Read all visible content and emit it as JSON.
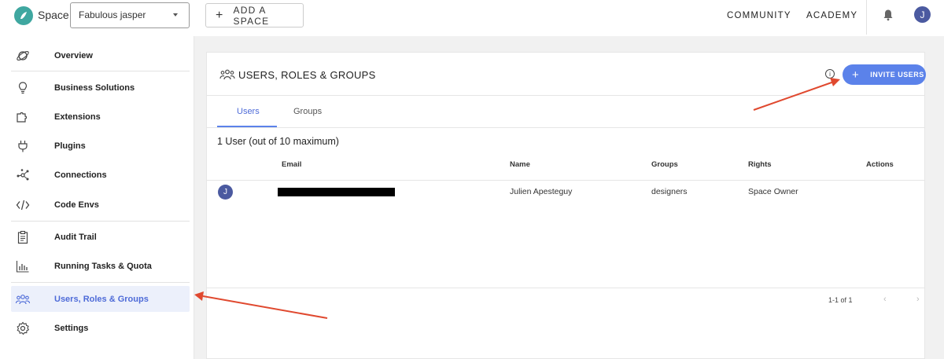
{
  "header": {
    "app_name": "Space",
    "space_selector": "Fabulous jasper",
    "add_space": "ADD A SPACE",
    "links": [
      "COMMUNITY",
      "ACADEMY"
    ],
    "user_initial": "J"
  },
  "sidebar": {
    "items": [
      {
        "label": "Overview",
        "icon": "planet-icon"
      },
      {
        "label": "Business Solutions",
        "icon": "lightbulb-icon"
      },
      {
        "label": "Extensions",
        "icon": "puzzle-icon"
      },
      {
        "label": "Plugins",
        "icon": "plug-icon"
      },
      {
        "label": "Connections",
        "icon": "connections-icon"
      },
      {
        "label": "Code Envs",
        "icon": "code-icon"
      },
      {
        "label": "Audit Trail",
        "icon": "clipboard-icon"
      },
      {
        "label": "Running Tasks & Quota",
        "icon": "bar-chart-icon"
      },
      {
        "label": "Users, Roles & Groups",
        "icon": "users-icon",
        "active": true
      },
      {
        "label": "Settings",
        "icon": "gear-icon"
      }
    ]
  },
  "main": {
    "title": "USERS, ROLES & GROUPS",
    "invite_button": "INVITE USERS",
    "tabs": [
      {
        "label": "Users",
        "active": true
      },
      {
        "label": "Groups"
      }
    ],
    "user_count": "1 User (out of 10 maximum)",
    "table": {
      "columns": [
        "Email",
        "Name",
        "Groups",
        "Rights",
        "Actions"
      ],
      "rows": [
        {
          "avatar": "J",
          "email": "",
          "name": "Julien Apesteguy",
          "groups": "designers",
          "rights": "Space Owner"
        }
      ]
    },
    "pagination": "1-1 of 1"
  },
  "colors": {
    "accent": "#5b82ea",
    "logo": "#3fa7a0",
    "avatar": "#4b5aa0",
    "annotation_arrow": "#e0492f"
  }
}
